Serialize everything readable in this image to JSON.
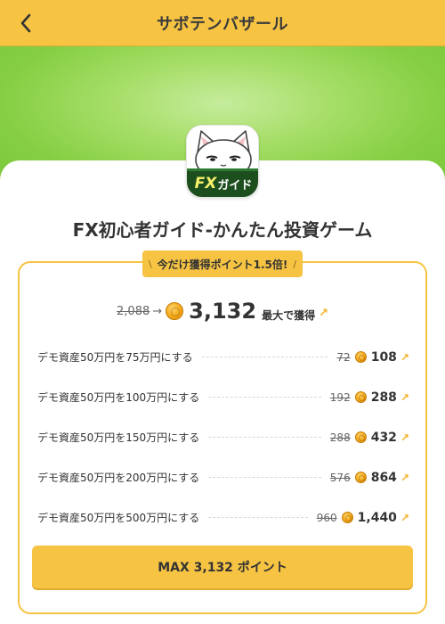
{
  "header": {
    "title": "サボテンバザール"
  },
  "app": {
    "title": "FX初心者ガイド-かんたん投資ゲーム",
    "icon_text_fx": "FX",
    "icon_text_guide": "ガイド"
  },
  "bonus": {
    "slash_left": "\\",
    "text": "今だけ獲得ポイント1.5倍!",
    "slash_right": "/"
  },
  "summary": {
    "old_total": "2,088",
    "arrow": "→",
    "new_total": "3,132",
    "label": "最大で獲得",
    "up_arrow": "↗"
  },
  "tasks": [
    {
      "label": "デモ資産50万円を75万円にする",
      "old": "72",
      "new": "108"
    },
    {
      "label": "デモ資産50万円を100万円にする",
      "old": "192",
      "new": "288"
    },
    {
      "label": "デモ資産50万円を150万円にする",
      "old": "288",
      "new": "432"
    },
    {
      "label": "デモ資産50万円を200万円にする",
      "old": "576",
      "new": "864"
    },
    {
      "label": "デモ資産50万円を500万円にする",
      "old": "960",
      "new": "1,440"
    }
  ],
  "task_up_arrow": "↗",
  "cta": {
    "label": "MAX 3,132 ポイント"
  },
  "colors": {
    "accent": "#f6c343",
    "banner_green": "#86cf43",
    "icon_dark_green": "#1d4f1e"
  }
}
